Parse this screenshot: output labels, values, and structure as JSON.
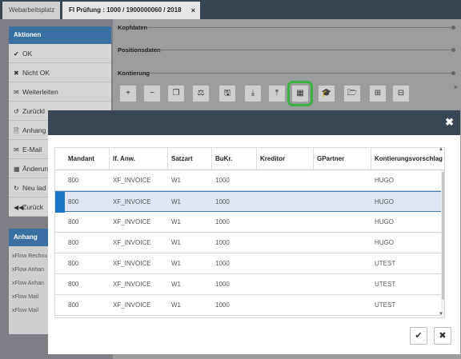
{
  "tabs": [
    {
      "label": "Webarbeitsplatz"
    },
    {
      "label": "FI Prüfung : 1000 / 1900000060 / 2018",
      "close_icon": "×"
    }
  ],
  "left_panel": {
    "title": "Aktionen",
    "items": [
      {
        "icon": "✔",
        "label": "OK"
      },
      {
        "icon": "✖",
        "label": "Nicht OK"
      },
      {
        "icon": "✉",
        "label": "Weiterleiten"
      },
      {
        "icon": "↺",
        "label": "Zurückl"
      },
      {
        "icon": "🗎",
        "label": "Anhang"
      },
      {
        "icon": "✉",
        "label": "E-Mail"
      },
      {
        "icon": "▦",
        "label": "Änderun"
      },
      {
        "icon": "↻",
        "label": "Neu lad"
      },
      {
        "icon": "◀◀",
        "label": "Zurück"
      }
    ]
  },
  "anhang_panel": {
    "title": "Anhang",
    "items": [
      "xFlow Rechnu",
      "xFlow Anhan",
      "xFlow Anhan",
      "xFlow Mail",
      "xFlow Mail"
    ]
  },
  "sections": [
    "Kopfdaten",
    "Positionsdaten",
    "Kontierung"
  ],
  "toolbar": [
    {
      "icon": "plus-icon",
      "glyph": "+"
    },
    {
      "icon": "minus-icon",
      "glyph": "−"
    },
    {
      "icon": "copy-icon",
      "glyph": "❐"
    },
    {
      "icon": "balance-icon",
      "glyph": "⚖"
    },
    {
      "icon": "save-icon",
      "glyph": "🖫"
    },
    {
      "icon": "download-icon",
      "glyph": "⤓"
    },
    {
      "icon": "upload-icon",
      "glyph": "⤒"
    },
    {
      "icon": "table-icon",
      "glyph": "▦",
      "highlighted": true
    },
    {
      "icon": "graduation-cap-icon",
      "glyph": "🎓"
    },
    {
      "icon": "folder-open-icon",
      "glyph": "🗁"
    },
    {
      "icon": "plus-square-icon",
      "glyph": "⊞"
    },
    {
      "icon": "minus-square-icon",
      "glyph": "⊟"
    }
  ],
  "modal": {
    "close_glyph": "✖",
    "columns": [
      "Mandant",
      "lf. Anw.",
      "Satzart",
      "BuKr.",
      "Kreditor",
      "GPartner",
      "Kontierungsvorschlag"
    ],
    "rows": [
      [
        "800",
        "XF_INVOICE",
        "W1",
        "1000",
        "",
        "",
        "HUGO"
      ],
      [
        "800",
        "XF_INVOICE",
        "W1",
        "1000",
        "",
        "",
        "HUGO"
      ],
      [
        "800",
        "XF_INVOICE",
        "W1",
        "1000",
        "",
        "",
        "HUGO"
      ],
      [
        "800",
        "XF_INVOICE",
        "W1",
        "1000",
        "",
        "",
        "HUGO"
      ],
      [
        "800",
        "XF_INVOICE",
        "W1",
        "1000",
        "",
        "",
        "UTEST"
      ],
      [
        "800",
        "XF_INVOICE",
        "W1",
        "1000",
        "",
        "",
        "UTEST"
      ],
      [
        "800",
        "XF_INVOICE",
        "W1",
        "1000",
        "",
        "",
        "UTEST"
      ]
    ],
    "selected_row": 1,
    "confirm_glyph": "✔",
    "cancel_glyph": "✖"
  }
}
